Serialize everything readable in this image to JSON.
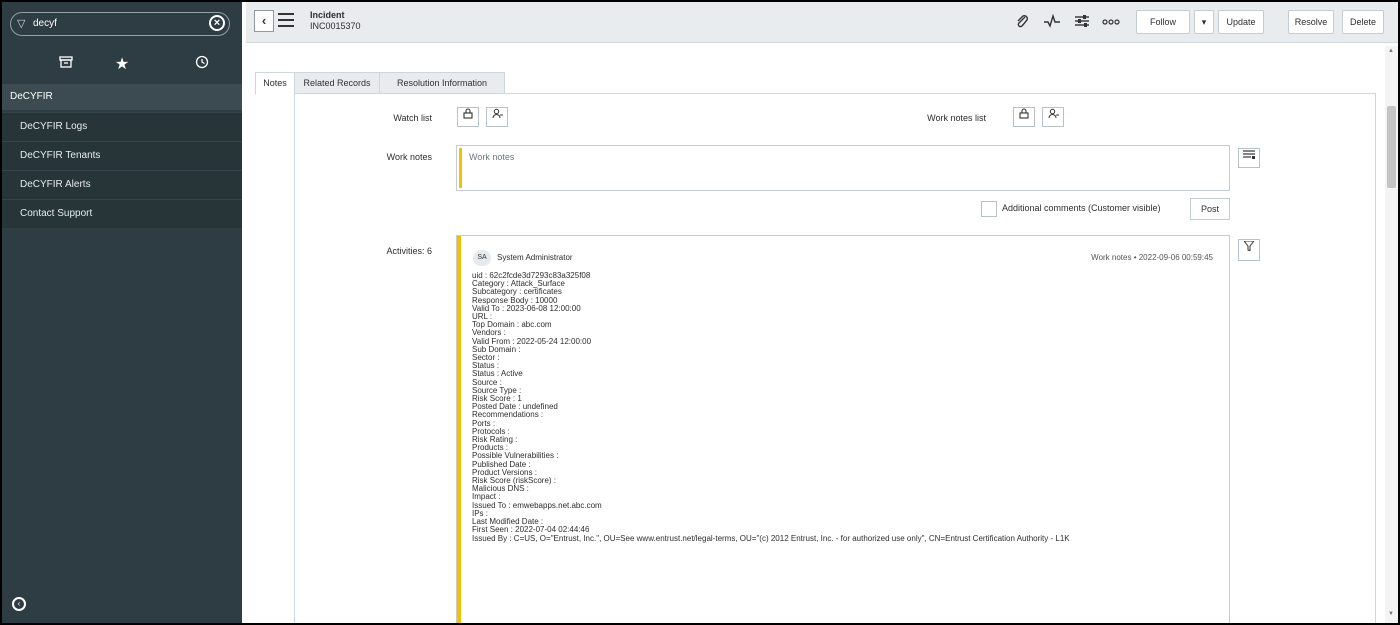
{
  "sidebar": {
    "filter_value": "decyf",
    "section_title": "DeCYFIR",
    "items": [
      {
        "label": "DeCYFIR Logs"
      },
      {
        "label": "DeCYFIR Tenants"
      },
      {
        "label": "DeCYFIR Alerts"
      },
      {
        "label": "Contact Support"
      }
    ],
    "nav_icons": [
      "archive-icon",
      "star-icon",
      "clock-icon"
    ]
  },
  "header": {
    "record_type": "Incident",
    "record_number": "INC0015370",
    "icons": [
      "attachment-icon",
      "activity-icon",
      "settings-icon",
      "more-icon"
    ],
    "follow_label": "Follow",
    "update_label": "Update",
    "resolve_label": "Resolve",
    "delete_label": "Delete"
  },
  "tabs": [
    {
      "label": "Notes",
      "active": true
    },
    {
      "label": "Related Records",
      "active": false
    },
    {
      "label": "Resolution Information",
      "active": false
    }
  ],
  "form": {
    "watch_list_label": "Watch list",
    "work_notes_list_label": "Work notes list",
    "work_notes_label": "Work notes",
    "work_notes_placeholder": "Work notes",
    "additional_comments_label": "Additional comments (Customer visible)",
    "post_label": "Post",
    "activities_label": "Activities: 6"
  },
  "activity": {
    "avatar_initials": "SA",
    "author": "System Administrator",
    "meta": "Work notes  •  2022-09-06 00:59:45",
    "lines": [
      "uid : 62c2fcde3d7293c83a325f08",
      "Category : Attack_Surface",
      "Subcategory : certificates",
      "Response Body : 10000",
      "Valid To : 2023-06-08 12:00:00",
      "URL :",
      "Top Domain : abc.com",
      "Vendors :",
      "Valid From : 2022-05-24 12:00:00",
      "Sub Domain :",
      "Sector :",
      "Status :",
      "Status : Active",
      "Source :",
      "Source Type :",
      "Risk Score : 1",
      "Posted Date : undefined",
      "Recommendations :",
      "Ports :",
      "Protocols :",
      "Risk Rating :",
      "Products :",
      "Possible Vulnerabilities :",
      "Published Date :",
      "Product Versions :",
      "Risk Score (riskScore) :",
      "Malicious DNS :",
      "Impact :",
      "Issued To : emwebapps.net.abc.com",
      "IPs :",
      "Last Modified Date :",
      "First Seen : 2022-07-04 02:44:46",
      "Issued By : C=US, O=\"Entrust, Inc.\", OU=See www.entrust.net/legal-terms, OU=\"(c) 2012 Entrust, Inc. - for authorized use only\", CN=Entrust Certification Authority - L1K"
    ]
  },
  "colors": {
    "sidebar_bg": "#2e3d43",
    "accent_yellow": "#f2c100",
    "header_bg": "#e8ecef"
  }
}
